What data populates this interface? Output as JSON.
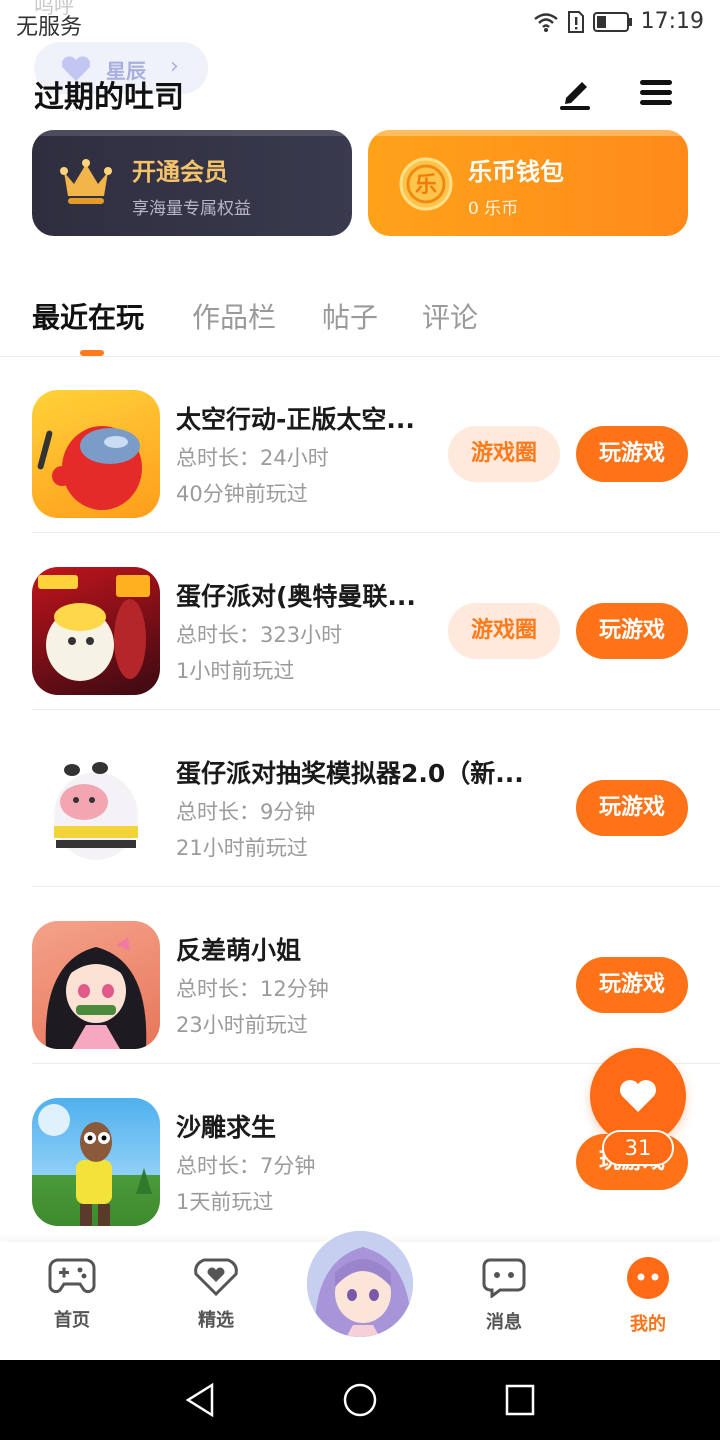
{
  "status_bar": {
    "carrier": "无服务",
    "ghost_text": "呜呼",
    "time": "17:19"
  },
  "header": {
    "level_label": "星辰",
    "level_chevron": "›",
    "username": "过期的吐司",
    "edit_icon": "pen-icon",
    "menu_icon": "menu-icon"
  },
  "cards": {
    "vip": {
      "title": "开通会员",
      "subtitle": "享海量专属权益",
      "icon": "crown-icon"
    },
    "wallet": {
      "title": "乐币钱包",
      "subtitle": "0 乐币",
      "icon_glyph": "乐"
    }
  },
  "tabs": [
    "最近在玩",
    "作品栏",
    "帖子",
    "评论"
  ],
  "active_tab": 0,
  "games": [
    {
      "title": "太空行动-正版太空...",
      "duration": "总时长：24小时",
      "last_played": "40分钟前玩过",
      "circle_label": "游戏圈",
      "play_label": "玩游戏"
    },
    {
      "title": "蛋仔派对(奥特曼联...",
      "duration": "总时长：323小时",
      "last_played": "1小时前玩过",
      "circle_label": "游戏圈",
      "play_label": "玩游戏"
    },
    {
      "title": "蛋仔派对抽奖模拟器2.0（新...",
      "duration": "总时长：9分钟",
      "last_played": "21小时前玩过",
      "play_label": "玩游戏"
    },
    {
      "title": "反差萌小姐",
      "duration": "总时长：12分钟",
      "last_played": "23小时前玩过",
      "play_label": "玩游戏"
    },
    {
      "title": "沙雕求生",
      "duration": "总时长：7分钟",
      "last_played": "1天前玩过",
      "play_label": "玩游戏"
    }
  ],
  "floating_like": {
    "count": "31",
    "icon": "heart-icon"
  },
  "bottom_nav": [
    {
      "label": "首页",
      "icon": "gamepad-icon"
    },
    {
      "label": "精选",
      "icon": "heart-badge-icon"
    },
    {
      "label": "消息",
      "icon": "chat-icon"
    },
    {
      "label": "我的",
      "icon": "profile-face-icon"
    }
  ],
  "colors": {
    "accent": "#ff7318",
    "vip_card": "#2e2e3f",
    "vip_text": "#f5c36a",
    "wallet_card": "#ff951a",
    "circle_button_bg": "#ffe9dc"
  }
}
